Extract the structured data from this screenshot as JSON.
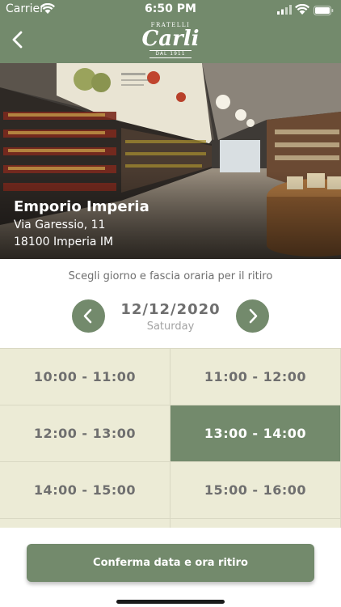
{
  "status_bar": {
    "carrier": "Carrier",
    "time": "6:50 PM"
  },
  "header": {
    "brand_top": "FRATELLI",
    "brand_name": "Carli",
    "brand_bottom": "DAL 1911",
    "color": "#738a6c"
  },
  "store": {
    "name": "Emporio Imperia",
    "address_line1": "Via Garessio, 11",
    "address_line2": "18100 Imperia IM"
  },
  "instructions": "Scegli giorno e fascia oraria per il ritiro",
  "date_picker": {
    "date": "12/12/2020",
    "weekday": "Saturday"
  },
  "slots": [
    {
      "label": "10:00 - 11:00",
      "selected": false
    },
    {
      "label": "11:00 - 12:00",
      "selected": false
    },
    {
      "label": "12:00 - 13:00",
      "selected": false
    },
    {
      "label": "13:00 - 14:00",
      "selected": true
    },
    {
      "label": "14:00 - 15:00",
      "selected": false
    },
    {
      "label": "15:00 - 16:00",
      "selected": false
    }
  ],
  "confirm_button": "Conferma data e ora ritiro",
  "icons": [
    "wifi-icon",
    "signal-icon",
    "battery-icon",
    "back-chevron-icon",
    "chevron-left-icon",
    "chevron-right-icon"
  ],
  "colors": {
    "accent": "#738a6c",
    "slot_bg": "#ecebd6",
    "text": "#6f6f6f"
  }
}
